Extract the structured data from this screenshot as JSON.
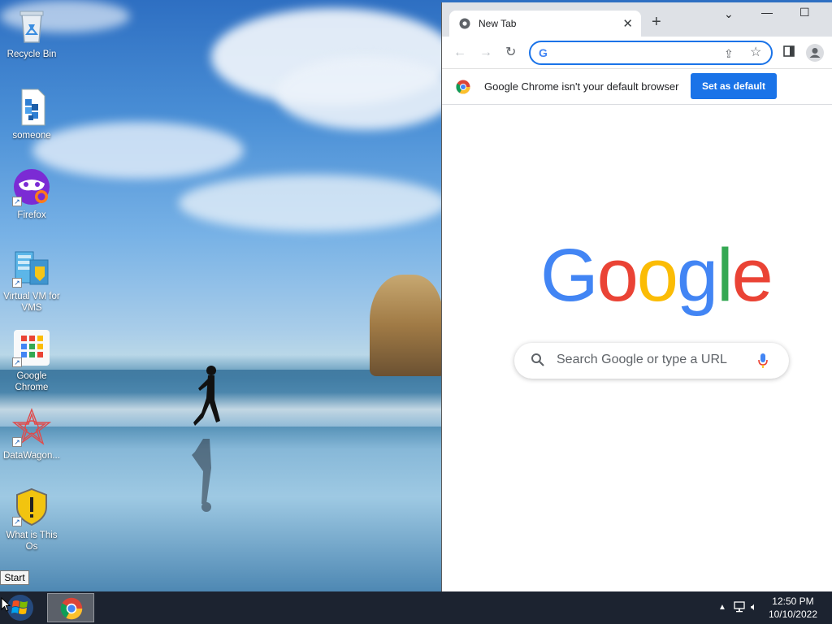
{
  "desktop": {
    "icons": [
      {
        "label": "Recycle Bin",
        "icon": "recycle-bin-icon"
      },
      {
        "label": "someone",
        "icon": "document-icon"
      },
      {
        "label": "Firefox",
        "icon": "firefox-icon"
      },
      {
        "label": "Virtual VM for VMS",
        "icon": "virtual-vm-icon"
      },
      {
        "label": "Google Chrome",
        "icon": "chrome-icon"
      },
      {
        "label": "DataWagon...",
        "icon": "datawagon-icon"
      },
      {
        "label": "What is This Os",
        "icon": "shield-warning-icon"
      }
    ]
  },
  "chrome": {
    "tab_title": "New Tab",
    "new_tab": "+",
    "omnibox_value": "",
    "infobar_text": "Google Chrome isn't your default browser",
    "set_default_label": "Set as default",
    "search_placeholder": "Search Google or type a URL",
    "accent": "#1a73e8"
  },
  "taskbar": {
    "start_tooltip": "Start",
    "time": "12:50 PM",
    "date": "10/10/2022"
  }
}
